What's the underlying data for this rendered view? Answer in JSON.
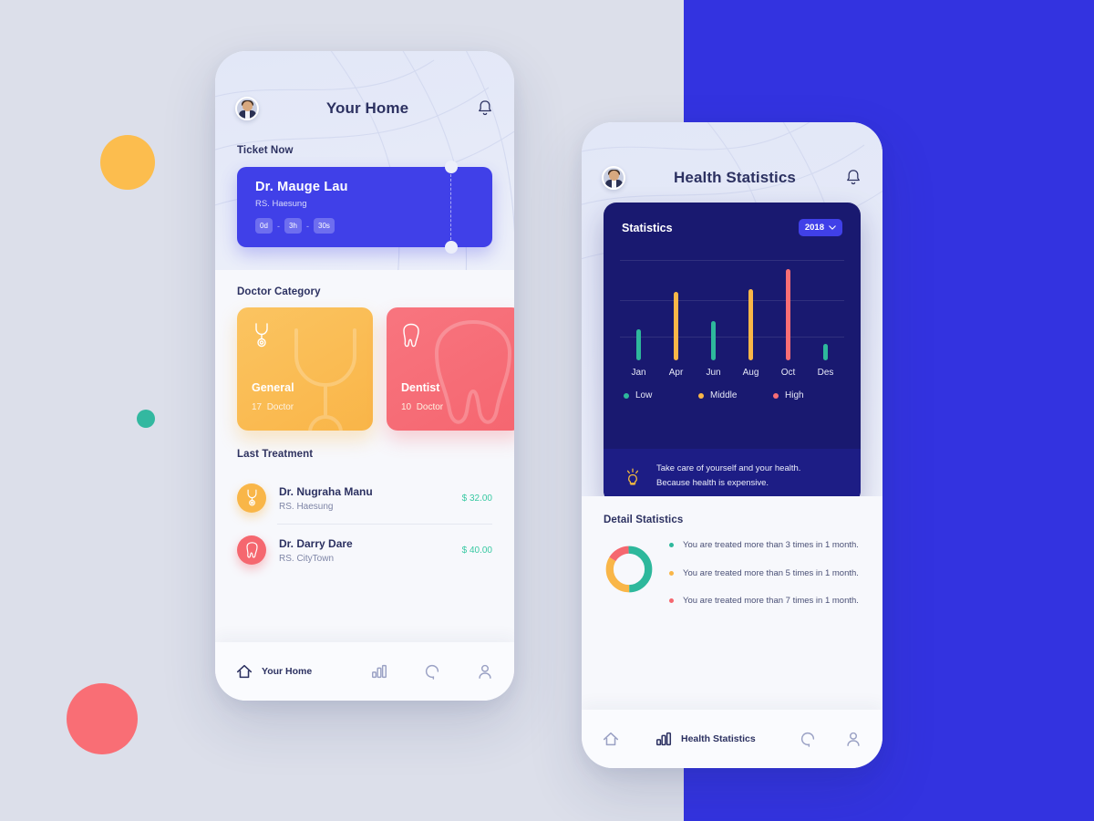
{
  "background": {
    "base_color": "#dcdfea",
    "panel_color": "#3333e0",
    "circles": [
      {
        "name": "yellow",
        "color": "#fcbd4e"
      },
      {
        "name": "teal",
        "color": "#33b8a0"
      },
      {
        "name": "red",
        "color": "#f96e75"
      }
    ]
  },
  "phone_home": {
    "title": "Your Home",
    "avatar_alt": "user-avatar",
    "ticket_section": {
      "title": "Ticket Now",
      "doctor": "Dr. Mauge Lau",
      "hospital": "RS. Haesung",
      "countdown": [
        "0d",
        "3h",
        "30s"
      ],
      "separator": "-"
    },
    "category_section": {
      "title": "Doctor Category",
      "cards": [
        {
          "name": "General",
          "count": "17",
          "unit": "Doctor",
          "icon": "stethoscope-icon",
          "color": "#f9b548"
        },
        {
          "name": "Dentist",
          "count": "10",
          "unit": "Doctor",
          "icon": "tooth-icon",
          "color": "#f5676f"
        }
      ]
    },
    "treatment_section": {
      "title": "Last Treatment",
      "rows": [
        {
          "doctor": "Dr. Nugraha Manu",
          "hospital": "RS. Haesung",
          "price": "$ 32.00",
          "icon": "stethoscope-icon",
          "color": "#f9b648"
        },
        {
          "doctor": "Dr. Darry Dare",
          "hospital": "RS. CityTown",
          "price": "$ 40.00",
          "icon": "tooth-icon",
          "color": "#f5676f"
        }
      ]
    },
    "nav": {
      "active_label": "Your Home",
      "items": [
        "home-icon",
        "bar-chart-icon",
        "chat-icon",
        "profile-icon"
      ]
    }
  },
  "phone_stats": {
    "title": "Health Statistics",
    "avatar_alt": "user-avatar",
    "stats_card": {
      "title": "Statistics",
      "year": "2018",
      "tip": {
        "line1": "Take care of yourself and your health.",
        "line2": "Because health is expensive.",
        "icon": "lightbulb-icon"
      }
    },
    "detail_section": {
      "title": "Detail Statistics",
      "items": [
        {
          "text": "You are treated more than 3 times in 1 month.",
          "color": "#2eb89c"
        },
        {
          "text": "You are treated more than 5 times in 1 month.",
          "color": "#f9b648"
        },
        {
          "text": "You are treated more than 7 times in 1 month.",
          "color": "#f5676f"
        }
      ]
    },
    "nav": {
      "active_label": "Health Statistics",
      "items": [
        "home-icon",
        "bar-chart-icon",
        "chat-icon",
        "profile-icon"
      ]
    }
  },
  "chart_data": [
    {
      "type": "bar",
      "title": "Statistics",
      "categories": [
        "Jan",
        "Apr",
        "Jun",
        "Aug",
        "Oct",
        "Des"
      ],
      "values": [
        34,
        75,
        43,
        78,
        100,
        18
      ],
      "bar_colors": [
        "#2eb89c",
        "#f9b648",
        "#2eb89c",
        "#f9b648",
        "#f96e75",
        "#2eb89c"
      ],
      "ylim": [
        0,
        110
      ],
      "gridlines": [
        110,
        62,
        26
      ],
      "legend": [
        {
          "label": "Low",
          "color": "#2eb89c"
        },
        {
          "label": "Middle",
          "color": "#f9b648"
        },
        {
          "label": "High",
          "color": "#f96e75"
        }
      ],
      "legend_position": "bottom",
      "xlabel": "",
      "ylabel": ""
    },
    {
      "type": "pie",
      "title": "Detail Statistics",
      "labels": [
        "Low",
        "Middle",
        "High"
      ],
      "values": [
        50,
        34,
        16
      ],
      "colors": [
        "#2eb89c",
        "#f9b648",
        "#f5676f"
      ],
      "donut": true
    }
  ]
}
